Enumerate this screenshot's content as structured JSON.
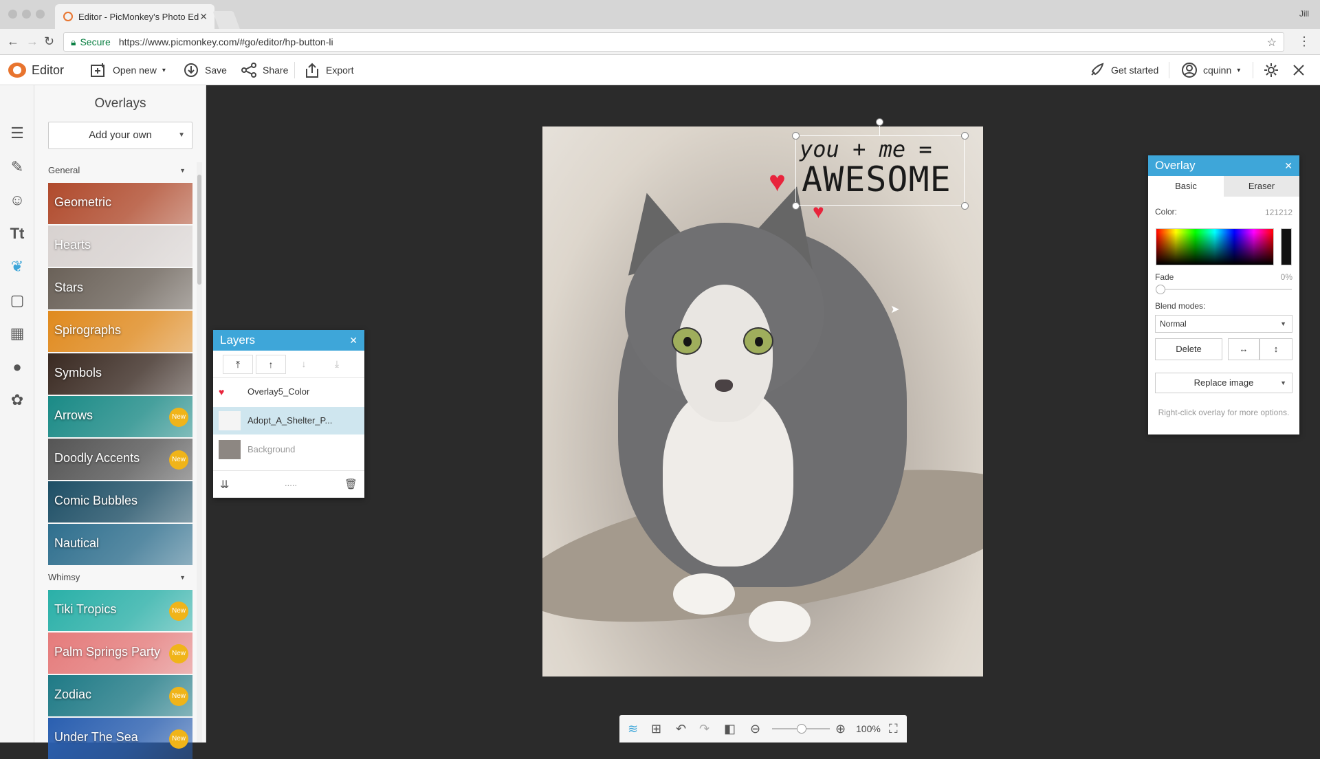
{
  "browser": {
    "tab_title": "Editor - PicMonkey's Photo Ed",
    "secure_label": "Secure",
    "url": "https://www.picmonkey.com/#go/editor/hp-button-li",
    "profile": "Jill"
  },
  "toolbar": {
    "app_title": "Editor",
    "open_new": "Open new",
    "save": "Save",
    "share": "Share",
    "export": "Export",
    "get_started": "Get started",
    "user": "cquinn"
  },
  "overlays_panel": {
    "title": "Overlays",
    "add_own": "Add your own",
    "groups": [
      {
        "label": "General",
        "items": [
          {
            "label": "Geometric",
            "badge": "",
            "color": "#b04a2c"
          },
          {
            "label": "Hearts",
            "badge": "",
            "color": "#d8d2d0"
          },
          {
            "label": "Stars",
            "badge": "",
            "color": "#6a6158"
          },
          {
            "label": "Spirographs",
            "badge": "",
            "color": "#e08a1e"
          },
          {
            "label": "Symbols",
            "badge": "",
            "color": "#3a2a22"
          },
          {
            "label": "Arrows",
            "badge": "New",
            "color": "#1a8a86"
          },
          {
            "label": "Doodly Accents",
            "badge": "New",
            "color": "#555555"
          },
          {
            "label": "Comic Bubbles",
            "badge": "",
            "color": "#1e4f66"
          },
          {
            "label": "Nautical",
            "badge": "",
            "color": "#2f6f8e"
          }
        ]
      },
      {
        "label": "Whimsy",
        "items": [
          {
            "label": "Tiki Tropics",
            "badge": "New",
            "color": "#2ab0a8"
          },
          {
            "label": "Palm Springs Party",
            "badge": "New",
            "color": "#e57b7b"
          },
          {
            "label": "Zodiac",
            "badge": "New",
            "color": "#1f7a86"
          },
          {
            "label": "Under The Sea",
            "badge": "New",
            "color": "#2a5fb0"
          }
        ]
      }
    ]
  },
  "canvas": {
    "overlay_line1": "you + me =",
    "overlay_line2": "AWESOME"
  },
  "layers": {
    "title": "Layers",
    "rows": [
      {
        "label": "Overlay5_Color",
        "selected": false
      },
      {
        "label": "Adopt_A_Shelter_P...",
        "selected": true
      },
      {
        "label": "Background",
        "selected": false
      }
    ],
    "footer_dots": "....."
  },
  "overlay_props": {
    "title": "Overlay",
    "tabs": [
      "Basic",
      "Eraser"
    ],
    "color_label": "Color:",
    "color_value": "121212",
    "fade_label": "Fade",
    "fade_value": "0%",
    "blend_label": "Blend modes:",
    "blend_value": "Normal",
    "delete": "Delete",
    "replace": "Replace image",
    "hint": "Right-click overlay for more options."
  },
  "zoom": {
    "level": "100%"
  },
  "colors": {
    "accent": "#3ea6d9",
    "badge": "#f0b419",
    "brand": "#e8742e"
  }
}
